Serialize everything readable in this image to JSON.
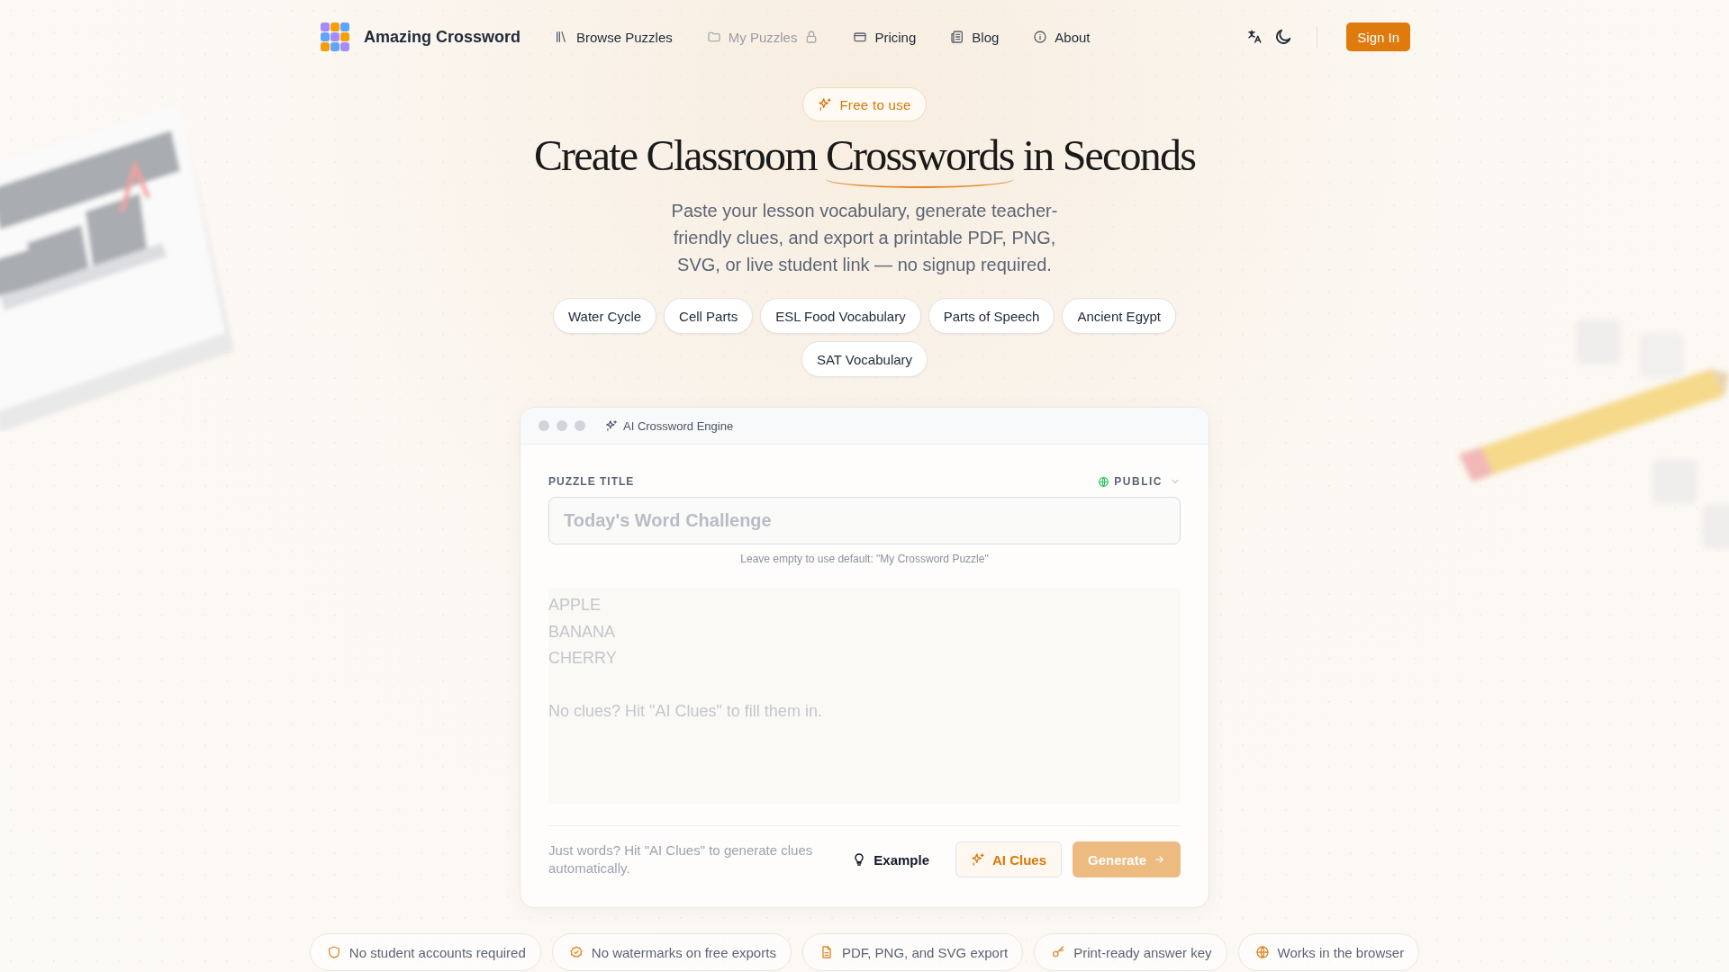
{
  "nav": {
    "brand": "Amazing Crossword",
    "links": [
      {
        "label": "Browse Puzzles",
        "disabled": false
      },
      {
        "label": "My Puzzles",
        "disabled": true
      },
      {
        "label": "Pricing",
        "disabled": false
      },
      {
        "label": "Blog",
        "disabled": false
      },
      {
        "label": "About",
        "disabled": false
      }
    ],
    "sign_in": "Sign In"
  },
  "hero": {
    "badge": "Free to use",
    "title_before": "Create Classroom ",
    "title_highlight": "Crosswords",
    "title_after": " in Seconds",
    "subtitle": "Paste your lesson vocabulary, generate teacher-friendly clues, and export a printable PDF, PNG, SVG, or live student link — no signup required.",
    "topics": [
      "Water Cycle",
      "Cell Parts",
      "ESL Food Vocabulary",
      "Parts of Speech",
      "Ancient Egypt",
      "SAT Vocabulary"
    ]
  },
  "editor": {
    "window_title": "AI Crossword Engine",
    "field_label": "PUZZLE TITLE",
    "visibility": "PUBLIC",
    "title_placeholder": "Today's Word Challenge",
    "hint": "Leave empty to use default: \"My Crossword Puzzle\"",
    "words_placeholder": "APPLE\nBANANA\nCHERRY\n\nNo clues? Hit \"AI Clues\" to fill them in.",
    "footer_note": "Just words? Hit \"AI Clues\" to generate clues automatically.",
    "buttons": [
      {
        "label": "Example",
        "kind": "ghost",
        "disabled": false
      },
      {
        "label": "AI Clues",
        "kind": "outline",
        "disabled": false
      },
      {
        "label": "Generate",
        "kind": "primary",
        "disabled": true
      }
    ]
  },
  "features": [
    "No student accounts required",
    "No watermarks on free exports",
    "PDF, PNG, and SVG export",
    "Print-ready answer key",
    "Works in the browser"
  ]
}
